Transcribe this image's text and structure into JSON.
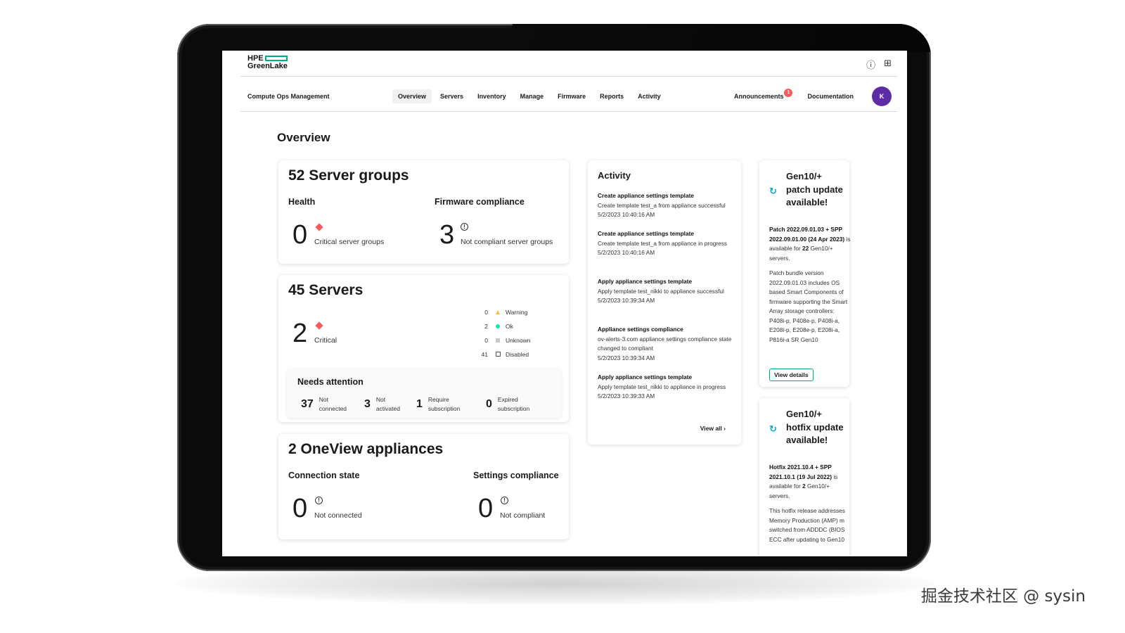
{
  "header": {
    "logo_line1": "HPE",
    "logo_line2": "GreenLake",
    "app_name": "Compute Ops Management",
    "tabs": [
      {
        "label": "Overview"
      },
      {
        "label": "Servers"
      },
      {
        "label": "Inventory"
      },
      {
        "label": "Manage"
      },
      {
        "label": "Firmware"
      },
      {
        "label": "Reports"
      },
      {
        "label": "Activity"
      }
    ],
    "announcements_label": "Announcements",
    "announcements_count": "1",
    "documentation_label": "Documentation",
    "avatar_initial": "K",
    "help_icon": "help-icon",
    "apps_icon": "grid-icon"
  },
  "page": {
    "title": "Overview"
  },
  "server_groups": {
    "title": "52 Server groups",
    "health_heading": "Health",
    "health_value": "0",
    "health_label": "Critical server groups",
    "firmware_heading": "Firmware compliance",
    "firmware_value": "3",
    "firmware_label": "Not compliant server groups"
  },
  "servers": {
    "title": "45 Servers",
    "critical_value": "2",
    "critical_label": "Critical",
    "legend": [
      {
        "count": "0",
        "label": "Warning"
      },
      {
        "count": "2",
        "label": "Ok"
      },
      {
        "count": "0",
        "label": "Unknown"
      },
      {
        "count": "41",
        "label": "Disabled"
      }
    ],
    "needs_attention": {
      "heading": "Needs attention",
      "items": [
        {
          "value": "37",
          "line1": "Not",
          "line2": "connected"
        },
        {
          "value": "3",
          "line1": "Not",
          "line2": "activated"
        },
        {
          "value": "1",
          "line1": "Require",
          "line2": "subscription"
        },
        {
          "value": "0",
          "line1": "Expired",
          "line2": "subscription"
        }
      ]
    }
  },
  "oneview": {
    "title": "2 OneView appliances",
    "connection_heading": "Connection state",
    "connection_value": "0",
    "connection_label": "Not connected",
    "settings_heading": "Settings compliance",
    "settings_value": "0",
    "settings_label": "Not compliant"
  },
  "activity": {
    "title": "Activity",
    "items": [
      {
        "title": "Create appliance settings template",
        "desc": "Create template test_a from appliance successful",
        "time": "5/2/2023 10:40:16 AM"
      },
      {
        "title": "Create appliance settings template",
        "desc": "Create template test_a from appliance in progress",
        "time": "5/2/2023 10:40:16 AM"
      },
      {
        "title": "Apply appliance settings template",
        "desc": "Apply template test_nikki to appliance successful",
        "time": "5/2/2023 10:39:34 AM"
      },
      {
        "title": "Appliance settings compliance",
        "desc": "ov-alerts-3.com appliance settings compliance state changed to compliant",
        "time": "5/2/2023 10:39:34 AM"
      },
      {
        "title": "Apply appliance settings template",
        "desc": "Apply template test_nikki to appliance in progress",
        "time": "5/2/2023 10:39:33 AM"
      }
    ],
    "view_all": "View all"
  },
  "notices": [
    {
      "title": "Gen10/+ patch update available!",
      "bold1": "Patch 2022.09.01.03 + SPP 2022.09.01.00 (24 Apr 2023)",
      "text1": " is available for ",
      "bold2": "22",
      "text2": " Gen10/+ servers.",
      "body": "Patch bundle version 2022.09.01.03 includes OS based Smart Components of firmware supporting the Smart Array storage controllers: P408i-p, P408e-p, P408i-a, E208i-p, E208e-p, E208i-a, P816i-a SR Gen10",
      "button": "View details"
    },
    {
      "title": "Gen10/+ hotfix update available!",
      "bold1": "Hotfix 2021.10.4 + SPP 2021.10.1 (19 Jul 2022)",
      "text1": " is available for ",
      "bold2": "2",
      "text2": " Gen10/+ servers.",
      "body": "This hotfix release addresses Memory Production (AMP) m switched from ADDDC (BIOS ECC after updating to Gen10"
    }
  ],
  "watermark": "掘金技术社区 @ sysin",
  "colors": {
    "brand": "#01a982",
    "critical": "#fc5a5a",
    "warning": "#ffbc44",
    "ok": "#17eba0",
    "avatar": "#5d2ca5"
  }
}
